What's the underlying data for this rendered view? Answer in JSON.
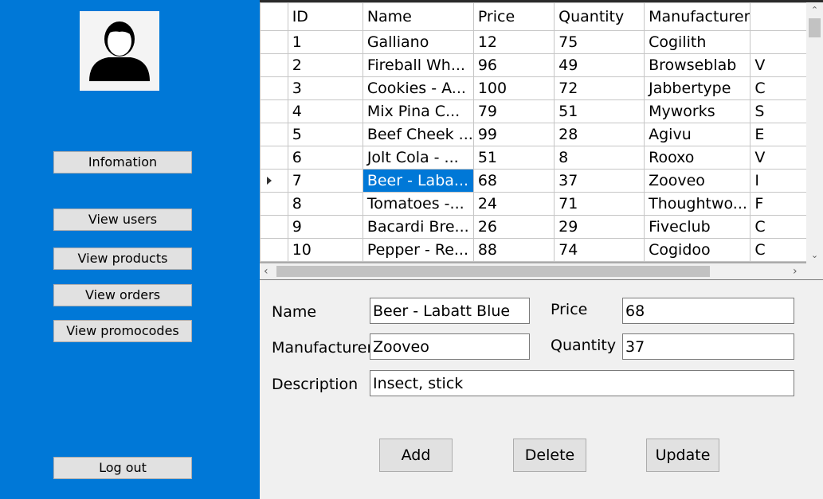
{
  "sidebar": {
    "avatar_icon": "user-icon",
    "buttons": {
      "information": "Infomation",
      "view_users": "View users",
      "view_products": "View products",
      "view_orders": "View orders",
      "view_promocodes": "View promocodes",
      "logout": "Log out"
    },
    "background": "#0078d7"
  },
  "grid": {
    "columns": [
      "ID",
      "Name",
      "Price",
      "Quantity",
      "Manufacturer"
    ],
    "selected_row_index": 6,
    "rows": [
      {
        "id": "1",
        "name": "Galliano",
        "price": "12",
        "quantity": "75",
        "manufacturer": "Cogilith",
        "extra": ""
      },
      {
        "id": "2",
        "name": "Fireball Wh...",
        "price": "96",
        "quantity": "49",
        "manufacturer": "Browseblab",
        "extra": "V"
      },
      {
        "id": "3",
        "name": "Cookies - A...",
        "price": "100",
        "quantity": "72",
        "manufacturer": "Jabbertype",
        "extra": "C"
      },
      {
        "id": "4",
        "name": "Mix Pina C...",
        "price": "79",
        "quantity": "51",
        "manufacturer": "Myworks",
        "extra": "S"
      },
      {
        "id": "5",
        "name": "Beef Cheek ...",
        "price": "99",
        "quantity": "28",
        "manufacturer": "Agivu",
        "extra": "E"
      },
      {
        "id": "6",
        "name": "Jolt Cola - ...",
        "price": "51",
        "quantity": "8",
        "manufacturer": "Rooxo",
        "extra": "V"
      },
      {
        "id": "7",
        "name": "Beer - Laba...",
        "price": "68",
        "quantity": "37",
        "manufacturer": "Zooveo",
        "extra": "I"
      },
      {
        "id": "8",
        "name": "Tomatoes -...",
        "price": "24",
        "quantity": "71",
        "manufacturer": "Thoughtwo...",
        "extra": "F"
      },
      {
        "id": "9",
        "name": "Bacardi Bre...",
        "price": "26",
        "quantity": "29",
        "manufacturer": "Fiveclub",
        "extra": "C"
      },
      {
        "id": "10",
        "name": "Pepper - Re...",
        "price": "88",
        "quantity": "74",
        "manufacturer": "Cogidoo",
        "extra": "C"
      }
    ]
  },
  "form": {
    "name_label": "Name",
    "name_value": "Beer - Labatt Blue",
    "price_label": "Price",
    "price_value": "68",
    "manufacturer_label": "Manufacturer",
    "manufacturer_value": "Zooveo",
    "quantity_label": "Quantity",
    "quantity_value": "37",
    "description_label": "Description",
    "description_value": "Insect, stick"
  },
  "actions": {
    "add": "Add",
    "delete": "Delete",
    "update": "Update"
  }
}
